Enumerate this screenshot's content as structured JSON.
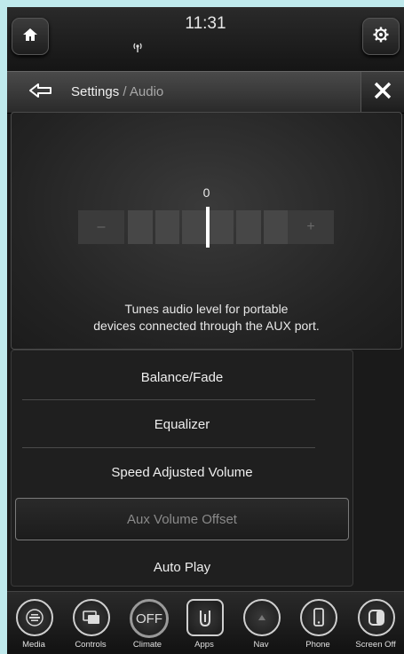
{
  "status_bar": {
    "time": "11:31",
    "icons": {
      "home": "home-icon",
      "settings": "gear-icon",
      "radio": "radio-signal-icon"
    }
  },
  "title_bar": {
    "crumb_settings": "Settings",
    "crumb_sep": " / ",
    "crumb_current": "Audio",
    "icons": {
      "back": "back-arrow-icon",
      "close": "close-icon"
    }
  },
  "aux_slider": {
    "value": "0",
    "minus": "–",
    "plus": "+",
    "level_fraction": 0.5,
    "description": "Tunes audio level for portable\ndevices connected through the AUX port."
  },
  "menu": {
    "items": [
      {
        "label": "Balance/Fade"
      },
      {
        "label": "Equalizer"
      },
      {
        "label": "Speed Adjusted Volume"
      },
      {
        "label": "Aux Volume Offset",
        "selected": true
      },
      {
        "label": "Auto Play"
      }
    ]
  },
  "dock": {
    "items": [
      {
        "label": "Media",
        "icon": "media-icon"
      },
      {
        "label": "Controls",
        "icon": "controls-icon"
      },
      {
        "label": "Climate",
        "icon": "climate-icon",
        "icon_text": "OFF"
      },
      {
        "label": "Apps",
        "icon": "apps-icon"
      },
      {
        "label": "Nav",
        "icon": "nav-icon"
      },
      {
        "label": "Phone",
        "icon": "phone-icon"
      },
      {
        "label": "Screen Off",
        "icon": "screen-off-icon"
      }
    ]
  }
}
